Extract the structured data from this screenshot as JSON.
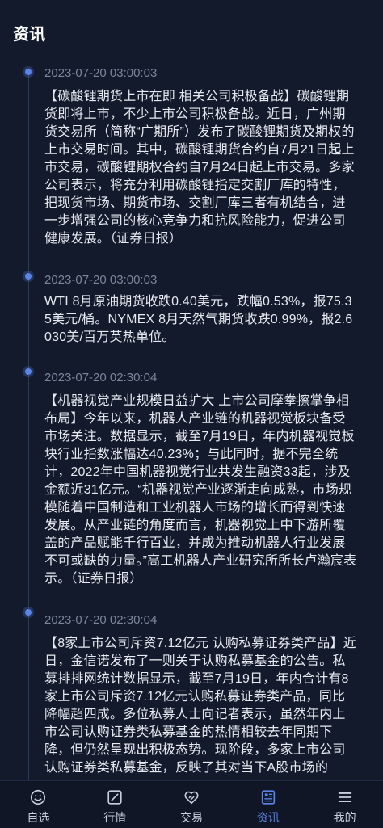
{
  "header": {
    "title": "资讯"
  },
  "news": [
    {
      "time": "2023-07-20 03:00:03",
      "content": "【碳酸锂期货上市在即 相关公司积极备战】碳酸锂期货即将上市，不少上市公司积极备战。近日，广州期货交易所（简称“广期所”）发布了碳酸锂期货及期权的上市交易时间。其中，碳酸锂期货合约自7月21日起上市交易，碳酸锂期权合约自7月24日起上市交易。多家公司表示，将充分利用碳酸锂指定交割厂库的特性，把现货市场、期货市场、交割厂库三者有机结合，进一步增强公司的核心竞争力和抗风险能力，促进公司健康发展。（证券日报）"
    },
    {
      "time": "2023-07-20 03:00:03",
      "content": "WTI 8月原油期货收跌0.40美元，跌幅0.53%，报75.35美元/桶。NYMEX 8月天然气期货收跌0.99%，报2.6030美/百万英热单位。"
    },
    {
      "time": "2023-07-20 02:30:04",
      "content": "【机器视觉产业规模日益扩大 上市公司摩拳擦掌争相布局】今年以来，机器人产业链的机器视觉板块备受市场关注。数据显示，截至7月19日，年内机器视觉板块行业指数涨幅达40.23%；与此同时，据不完全统计，2022年中国机器视觉行业共发生融资33起，涉及金额近31亿元。“机器视觉产业逐渐走向成熟，市场规模随着中国制造和工业机器人市场的增长而得到快速发展。从产业链的角度而言，机器视觉上中下游所覆盖的产品赋能千行百业，并成为推动机器人行业发展不可或缺的力量。”高工机器人产业研究所所长卢瀚宸表示。（证券日报）"
    },
    {
      "time": "2023-07-20 02:30:04",
      "content": "【8家上市公司斥资7.12亿元 认购私募证券类产品】近日，金信诺发布了一则关于认购私募基金的公告。私募排排网统计数据显示，截至7月19日，年内合计有8家上市公司斥资7.12亿元认购私募证券类产品，同比降幅超四成。多位私募人士向记者表示，虽然年内上市公司认购证券类私募基金的热情相较去年同期下降，但仍然呈现出积极态势。现阶段，多家上市公司认购证券类私募基金，反映了其对当下A股市场的"
    }
  ],
  "tabbar": {
    "tabs": [
      {
        "label": "自选",
        "icon": "smile-icon"
      },
      {
        "label": "行情",
        "icon": "chart-square-icon"
      },
      {
        "label": "交易",
        "icon": "heart-exchange-icon"
      },
      {
        "label": "资讯",
        "icon": "news-icon"
      },
      {
        "label": "我的",
        "icon": "menu-icon"
      }
    ],
    "active": "资讯",
    "active_color": "#5b84e6"
  }
}
